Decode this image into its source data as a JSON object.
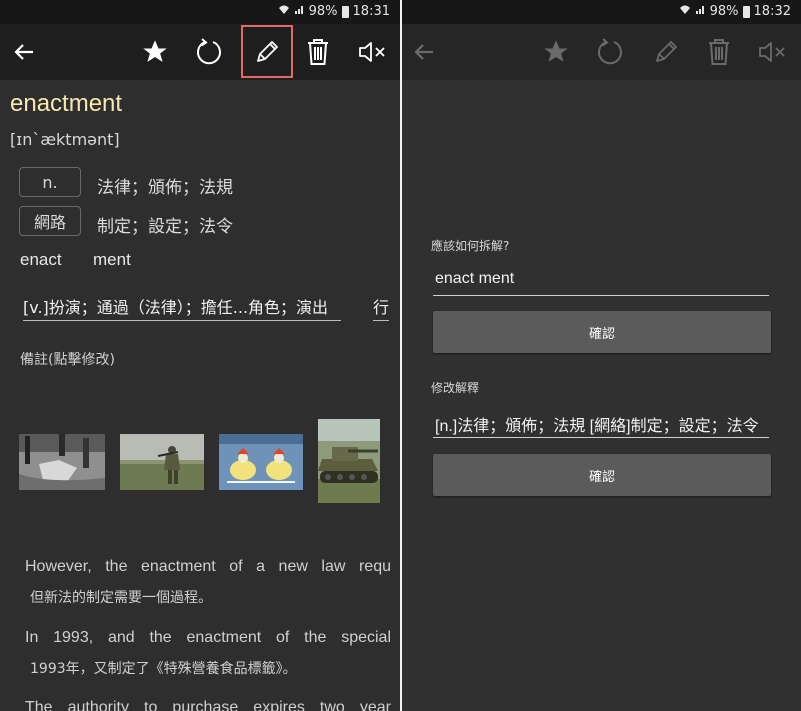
{
  "left": {
    "status": {
      "battery": "98%",
      "time": "18:31"
    },
    "toolbar": {
      "icons": [
        "back-arrow-icon",
        "star-icon",
        "refresh-icon",
        "pencil-icon",
        "trash-icon",
        "mute-icon"
      ],
      "highlight_color": "#e36a63"
    },
    "entry": {
      "word": "enactment",
      "phonetic": "[ɪn`æktmənt]",
      "pos": [
        {
          "tag": "n.",
          "definition": "法律；頒佈；法規"
        },
        {
          "tag": "網路",
          "definition": "制定；設定；法令"
        }
      ],
      "split": [
        "enact",
        "ment"
      ],
      "chips": [
        "[v.]扮演；通過（法律）；擔任...角色；演出",
        "行"
      ],
      "note_label": "備註(點擊修改)",
      "images": [
        "street-scene-bw",
        "soldier-field",
        "cartoon-ducks",
        "tank"
      ],
      "examples": [
        {
          "en": "However, the enactment of a new law requ",
          "zh": "但新法的制定需要一個過程。"
        },
        {
          "en": "In 1993, and the enactment of the special",
          "zh": "1993年，又制定了《特殊營養食品標籤》。"
        },
        {
          "en": "The authority to purchase expires two year",
          "zh": ""
        }
      ]
    }
  },
  "right": {
    "status": {
      "battery": "98%",
      "time": "18:32"
    },
    "split_form": {
      "label": "應該如何拆解?",
      "value": "enact ment",
      "confirm": "確認"
    },
    "definition_form": {
      "label": "修改解釋",
      "value": "[n.]法律；頒佈；法規 [網絡]制定；設定；法令",
      "confirm": "確認"
    }
  }
}
